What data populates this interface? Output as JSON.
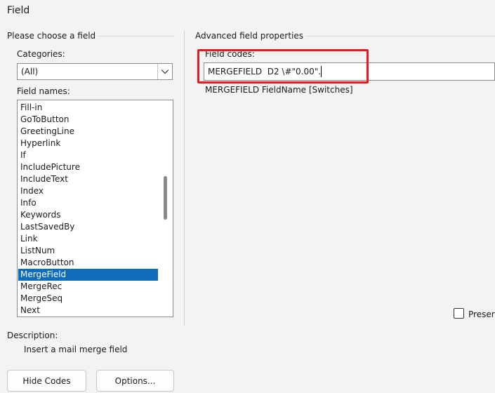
{
  "window": {
    "title": "Field"
  },
  "left_panel": {
    "section_title": "Please choose a field",
    "categories_label": "Categories:",
    "categories_value": "(All)",
    "field_names_label": "Field names:",
    "field_names": [
      "Fill-in",
      "GoToButton",
      "GreetingLine",
      "Hyperlink",
      "If",
      "IncludePicture",
      "IncludeText",
      "Index",
      "Info",
      "Keywords",
      "LastSavedBy",
      "Link",
      "ListNum",
      "MacroButton",
      "MergeField",
      "MergeRec",
      "MergeSeq",
      "Next"
    ],
    "selected_field": "MergeField",
    "description_label": "Description:",
    "description_text": "Insert a mail merge field"
  },
  "right_panel": {
    "section_title": "Advanced field properties",
    "field_codes_label": "Field codes:",
    "field_codes_value": "MERGEFIELD  D2 \\#\"0.00\".",
    "syntax_hint": "MERGEFIELD FieldName [Switches]",
    "preserve_label": "Preser"
  },
  "buttons": {
    "hide_codes": "Hide Codes",
    "options": "Options..."
  },
  "colors": {
    "selection": "#0f6cbd",
    "highlight_box": "#e51b24",
    "background": "#f3f3f3"
  }
}
